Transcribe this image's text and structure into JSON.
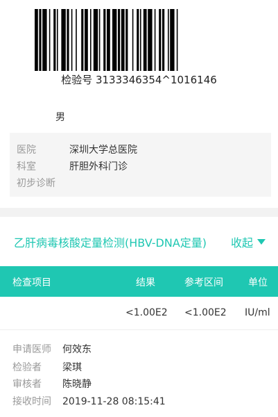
{
  "header": {
    "barcode_label": "检验号 3133346354^1016146",
    "gender": "男"
  },
  "patient_info": [
    {
      "label": "医院",
      "value": "深圳大学总医院"
    },
    {
      "label": "科室",
      "value": "肝胆外科门诊"
    },
    {
      "label": "初步诊断",
      "value": ""
    }
  ],
  "section": {
    "title": "乙肝病毒核酸定量检测(HBV-DNA定量)",
    "collapse_label": "收起"
  },
  "table": {
    "columns": [
      "检查项目",
      "结果",
      "参考区间",
      "单位"
    ],
    "rows": [
      {
        "item": "",
        "result": "<1.00E2",
        "range": "<1.00E2",
        "unit": "IU/ml"
      }
    ]
  },
  "meta": [
    {
      "label": "申请医师",
      "value": "何效东"
    },
    {
      "label": "检验者",
      "value": "梁琪"
    },
    {
      "label": "审核者",
      "value": "陈晓静"
    },
    {
      "label": "接收时间",
      "value": "2019-11-28 08:15:41"
    }
  ],
  "colors": {
    "accent": "#1fc7b2"
  },
  "icons": {
    "collapse": "triangle-down-icon"
  }
}
